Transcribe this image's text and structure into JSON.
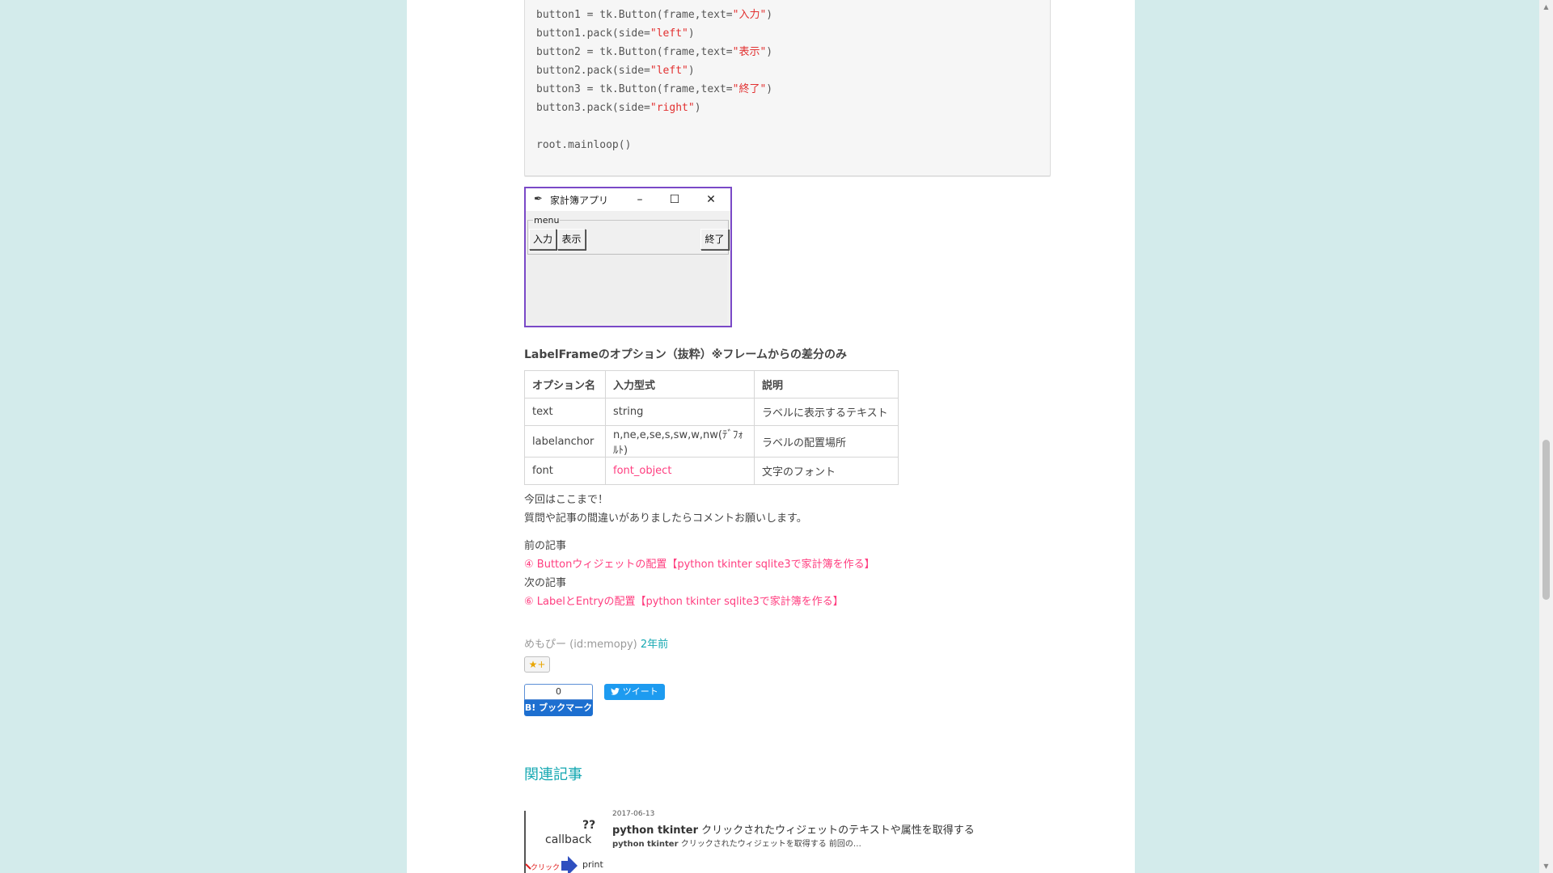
{
  "code": {
    "lines": [
      [
        [
          "button1 = tk.Button(frame,text=",
          ""
        ],
        [
          "\"入力\"",
          "str"
        ],
        [
          ")",
          ""
        ]
      ],
      [
        [
          "button1.pack(side=",
          ""
        ],
        [
          "\"left\"",
          "str"
        ],
        [
          ")",
          ""
        ]
      ],
      [
        [
          "button2 = tk.Button(frame,text=",
          ""
        ],
        [
          "\"表示\"",
          "str"
        ],
        [
          ")",
          ""
        ]
      ],
      [
        [
          "button2.pack(side=",
          ""
        ],
        [
          "\"left\"",
          "str"
        ],
        [
          ")",
          ""
        ]
      ],
      [
        [
          "button3 = tk.Button(frame,text=",
          ""
        ],
        [
          "\"終了\"",
          "str"
        ],
        [
          ")",
          ""
        ]
      ],
      [
        [
          "button3.pack(side=",
          ""
        ],
        [
          "\"right\"",
          "str"
        ],
        [
          ")",
          ""
        ]
      ],
      [],
      [
        [
          "root.mainloop()",
          ""
        ]
      ]
    ]
  },
  "tk_window": {
    "title": "家計簿アプリ",
    "feather_icon": "feather-icon",
    "minimize": "–",
    "maximize": "☐",
    "close": "✕",
    "labelframe_text": "menu",
    "buttons": {
      "input": "入力",
      "show": "表示",
      "exit": "終了"
    }
  },
  "options_section": {
    "heading": "LabelFrameのオプション（抜粋）※フレームからの差分のみ",
    "headers": [
      "オプション名",
      "入力型式",
      "説明"
    ],
    "rows": [
      [
        "text",
        "string",
        "ラベルに表示するテキスト"
      ],
      [
        "labelanchor",
        "n,ne,e,se,s,sw,w,nw(ﾃﾞﾌｫﾙﾄ)",
        "ラベルの配置場所"
      ],
      [
        "font",
        "font_object",
        "文字のフォント"
      ]
    ]
  },
  "closing": {
    "line1": "今回はここまで！",
    "line2": "質問や記事の間違いがありましたらコメントお願いします。"
  },
  "navigation": {
    "prev_label": "前の記事",
    "prev_link": "④ Buttonウィジェットの配置【python tkinter sqlite3で家計簿を作る】",
    "next_label": "次の記事",
    "next_link": "⑥ LabelとEntryの配置【python tkinter sqlite3で家計簿を作る】"
  },
  "byline": {
    "author": "めもぴー (id:memopy)",
    "date": "2年前"
  },
  "share": {
    "star_label": "★+",
    "hatena_count": "0",
    "hatena_label": "B! ブックマーク",
    "tweet_label": "ツイート"
  },
  "related": {
    "heading": "関連記事",
    "item": {
      "date": "2017-06-13",
      "title_bold": "python tkinter",
      "title_rest": " クリックされたウィジェットのテキストや属性を取得する",
      "excerpt_bold": "python tkinter",
      "excerpt_rest": " クリックされたウィジェットを取得する 前回の…",
      "thumb": {
        "qmark": "??",
        "callback": "callback",
        "click": "クリック",
        "print": "print"
      }
    }
  },
  "colors": {
    "background": "#d3ebeb",
    "link": "#ff3d7f",
    "accent": "#16a8b2",
    "code_string": "#e23030",
    "tk_border": "#7a49c7"
  }
}
